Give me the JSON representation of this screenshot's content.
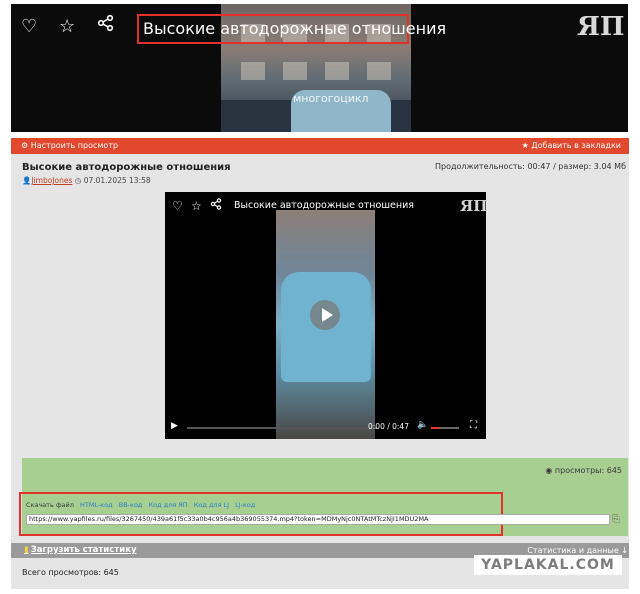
{
  "banner": {
    "title": "Высокие автодорожные отношения",
    "logo": "ЯП",
    "watermark": "многогоцикл"
  },
  "toolbar": {
    "customize": "Настроить просмотр",
    "bookmark": "Добавить в закладки"
  },
  "post": {
    "title": "Высокие автодорожные отношения",
    "author": "JimboJones",
    "date": "07.01.2025 13:58",
    "duration_info": "Продолжительность: 00:47 / размер: 3.04 Мб"
  },
  "player": {
    "title": "Высокие автодорожные отношения",
    "logo": "ЯП",
    "time": "0:00 / 0:47",
    "volume_fraction": 0.3
  },
  "share": {
    "views": "просмотры: 645",
    "links": [
      "Скачать файл",
      "HTML-код",
      "BB-код",
      "Код для ЯП",
      "Код для LJ",
      "LJ-код"
    ],
    "url": "https://www.yapfiles.ru/files/3267450/439a61f5c33a0b4c956a4b369055374.mp4?token=MDMyNjc0NTAtMTczNjI1MDU2MA"
  },
  "stats": {
    "load": "Загрузить статистику",
    "right": "Статистика и данные ↓",
    "total": "Всего просмотров: 645"
  },
  "footer": {
    "site": "YAPLAKAL.COM"
  }
}
